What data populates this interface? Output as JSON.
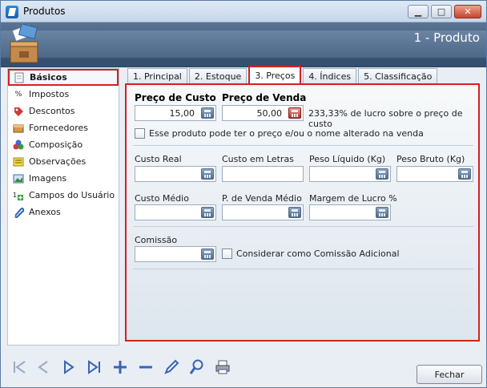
{
  "window": {
    "title": "Produtos",
    "header_title": "1 - Produto"
  },
  "sidebar": {
    "items": [
      {
        "label": "Básicos",
        "icon": "document-icon"
      },
      {
        "label": "Impostos",
        "icon": "percent-calc-icon"
      },
      {
        "label": "Descontos",
        "icon": "tag-icon"
      },
      {
        "label": "Fornecedores",
        "icon": "supplier-icon"
      },
      {
        "label": "Composição",
        "icon": "composition-icon"
      },
      {
        "label": "Observações",
        "icon": "notes-icon"
      },
      {
        "label": "Imagens",
        "icon": "images-icon"
      },
      {
        "label": "Campos do Usuário",
        "icon": "user-fields-icon"
      },
      {
        "label": "Anexos",
        "icon": "attachment-icon"
      }
    ]
  },
  "tabs": [
    {
      "label": "1. Principal"
    },
    {
      "label": "2. Estoque"
    },
    {
      "label": "3. Preços"
    },
    {
      "label": "4. Índices"
    },
    {
      "label": "5. Classificação"
    }
  ],
  "prices": {
    "custo_label": "Preço de Custo",
    "custo_value": "15,00",
    "venda_label": "Preço de Venda",
    "venda_value": "50,00",
    "lucro_text": "233,33% de lucro sobre o preço de custo",
    "alter_checkbox_label": "Esse produto pode ter o preço e/ou o nome alterado na venda"
  },
  "fields": {
    "custo_real": "Custo Real",
    "custo_letras": "Custo em Letras",
    "peso_liquido": "Peso Líquido (Kg)",
    "peso_bruto": "Peso Bruto (Kg)",
    "custo_medio": "Custo Médio",
    "p_venda_medio": "P. de Venda Médio",
    "margem_lucro": "Margem de Lucro %",
    "comissao": "Comissão",
    "comissao_adicional": "Considerar como Comissão Adicional"
  },
  "footer": {
    "close_label": "Fechar"
  },
  "colors": {
    "highlight": "#d42020",
    "header": "#3b5676"
  }
}
